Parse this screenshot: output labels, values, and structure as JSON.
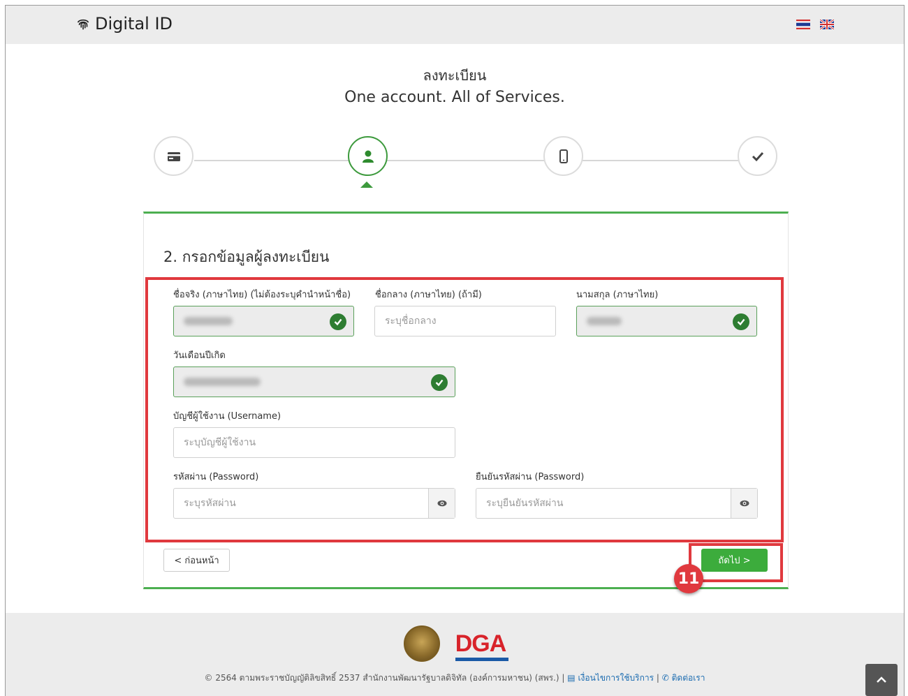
{
  "header": {
    "brand": "Digital ID"
  },
  "page": {
    "title_th": "ลงทะเบียน",
    "title_en": "One account. All of Services."
  },
  "steps": [
    {
      "icon": "id-card-icon",
      "active": false
    },
    {
      "icon": "user-icon",
      "active": true
    },
    {
      "icon": "mobile-icon",
      "active": false
    },
    {
      "icon": "check-icon",
      "active": false
    }
  ],
  "form": {
    "section_title": "2. กรอกข้อมูลผู้ลงทะเบียน",
    "first_name": {
      "label": "ชื่อจริง (ภาษาไทย) (ไม่ต้องระบุคำนำหน้าชื่อ)"
    },
    "middle_name": {
      "label": "ชื่อกลาง (ภาษาไทย) (ถ้ามี)",
      "placeholder": "ระบุชื่อกลาง"
    },
    "last_name": {
      "label": "นามสกุล (ภาษาไทย)"
    },
    "birth_date": {
      "label": "วันเดือนปีเกิด"
    },
    "username": {
      "label": "บัญชีผู้ใช้งาน (Username)",
      "placeholder": "ระบุบัญชีผู้ใช้งาน"
    },
    "password": {
      "label": "รหัสผ่าน (Password)",
      "placeholder": "ระบุรหัสผ่าน"
    },
    "confirm_password": {
      "label": "ยืนยันรหัสผ่าน (Password)",
      "placeholder": "ระบุยืนยันรหัสผ่าน"
    },
    "prev_label": "< ก่อนหน้า",
    "next_label": "ถัดไป >"
  },
  "annotation": {
    "badge": "11"
  },
  "footer": {
    "copyright": "© 2564 ตามพระราชบัญญัติลิขสิทธิ์ 2537 สำนักงานพัฒนารัฐบาลดิจิทัล (องค์การมหาชน) (สพร.) |",
    "terms_link": "เงื่อนไขการใช้บริการ",
    "separator": "|",
    "contact_link": "ติดต่อเรา",
    "logo_text": "DGA"
  },
  "colors": {
    "accent": "#3cac3c",
    "highlight": "#e0393e",
    "valid_check": "#2e7d32"
  }
}
